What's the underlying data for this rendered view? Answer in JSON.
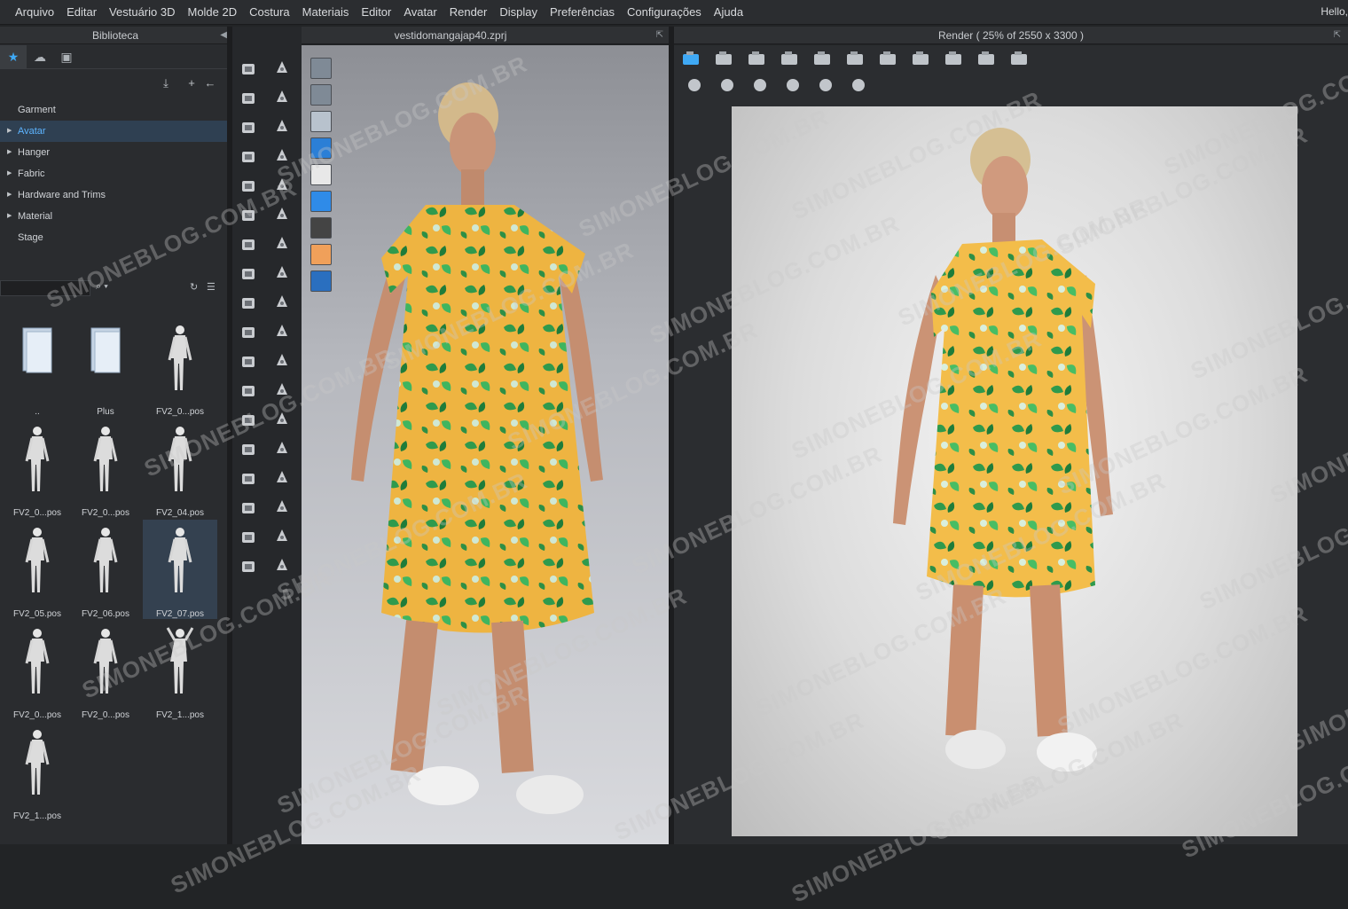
{
  "menu": [
    "Arquivo",
    "Editar",
    "Vestuário 3D",
    "Molde 2D",
    "Costura",
    "Materiais",
    "Editor",
    "Avatar",
    "Render",
    "Display",
    "Preferências",
    "Configurações",
    "Ajuda"
  ],
  "user_greeting": "Hello,",
  "library": {
    "title": "Biblioteca",
    "tree": [
      {
        "label": "Garment",
        "arrow": false,
        "selected": false
      },
      {
        "label": "Avatar",
        "arrow": true,
        "selected": true
      },
      {
        "label": "Hanger",
        "arrow": true,
        "selected": false
      },
      {
        "label": "Fabric",
        "arrow": true,
        "selected": false
      },
      {
        "label": "Hardware and Trims",
        "arrow": true,
        "selected": false
      },
      {
        "label": "Material",
        "arrow": true,
        "selected": false
      },
      {
        "label": "Stage",
        "arrow": false,
        "selected": false
      }
    ],
    "search_placeholder": "",
    "items": [
      {
        "label": "..",
        "kind": "folder"
      },
      {
        "label": "Plus",
        "kind": "folder"
      },
      {
        "label": "FV2_0...pos",
        "kind": "pose"
      },
      {
        "label": "FV2_0...pos",
        "kind": "pose"
      },
      {
        "label": "FV2_0...pos",
        "kind": "pose"
      },
      {
        "label": "FV2_04.pos",
        "kind": "pose"
      },
      {
        "label": "FV2_05.pos",
        "kind": "pose"
      },
      {
        "label": "FV2_06.pos",
        "kind": "pose"
      },
      {
        "label": "FV2_07.pos",
        "kind": "pose",
        "selected": true
      },
      {
        "label": "FV2_0...pos",
        "kind": "pose"
      },
      {
        "label": "FV2_0...pos",
        "kind": "pose"
      },
      {
        "label": "FV2_1...pos",
        "kind": "pose"
      },
      {
        "label": "FV2_1...pos",
        "kind": "pose"
      }
    ]
  },
  "viewport_3d": {
    "title": "vestidomangajap40.zprj"
  },
  "render": {
    "title": "Render ( 25% of 2550 x 3300 )"
  },
  "watermark": "SIMONEBLOG.COM.BR",
  "colors": {
    "accent": "#3fa9f5",
    "dress": "#f2b544",
    "leaf": "#2e9a4a"
  }
}
